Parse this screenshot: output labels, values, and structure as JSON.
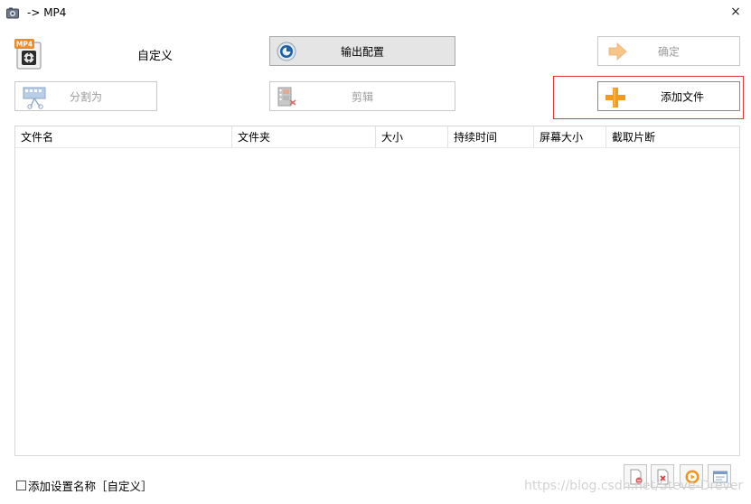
{
  "window": {
    "title": "-> MP4",
    "close_symbol": "×"
  },
  "format": {
    "badge": "MP4",
    "preset_label": "自定义"
  },
  "toolbar": {
    "output_config_label": "输出配置",
    "ok_label": "确定",
    "split_label": "分割为",
    "edit_label": "剪辑",
    "add_file_label": "添加文件"
  },
  "file_list": {
    "columns": [
      "文件名",
      "文件夹",
      "大小",
      "持续时间",
      "屏幕大小",
      "截取片断"
    ],
    "rows": []
  },
  "footer": {
    "checkbox_label": "添加设置名称［自定义］",
    "checkbox_checked": false,
    "tools": [
      "remove-file-icon",
      "clear-list-icon",
      "play-icon",
      "properties-icon"
    ]
  },
  "watermark": "https://blog.csdn.net/Steve-Drever",
  "colors": {
    "highlight_border": "#e0383a",
    "add_icon": "#f39a1e",
    "ok_icon": "#f6c58a"
  }
}
